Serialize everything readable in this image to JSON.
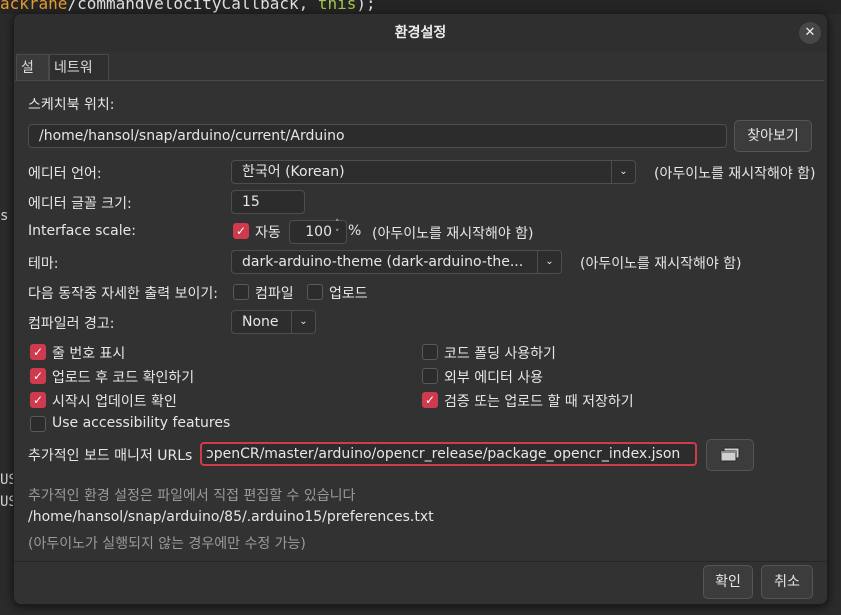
{
  "background": {
    "code_line_parts": [
      "ackrane",
      "/commandVelocityCallback",
      ", ",
      "this",
      ");"
    ],
    "left_fragments": [
      "s T",
      "US",
      "US"
    ]
  },
  "dialog": {
    "title": "환경설정",
    "close_glyph": "✕",
    "tabs": [
      "설정",
      "네트워크"
    ],
    "sketchbook": {
      "label": "스케치북 위치:",
      "path": "/home/hansol/snap/arduino/current/Arduino",
      "browse_label": "찾아보기"
    },
    "editor_language": {
      "label": "에디터 언어:",
      "value": "한국어 (Korean)",
      "note": "(아두이노를 재시작해야 함)"
    },
    "font_size": {
      "label": "에디터 글꼴 크기:",
      "value": "15"
    },
    "interface_scale": {
      "label": "Interface scale:",
      "auto_label": "자동",
      "auto_checked": true,
      "value": "100",
      "unit": "%",
      "note": "(아두이노를 재시작해야 함)"
    },
    "theme": {
      "label": "테마:",
      "value": "dark-arduino-theme  (dark-arduino-the...",
      "note": "(아두이노를 재시작해야 함)"
    },
    "verbose": {
      "label": "다음 동작중 자세한 출력 보이기:",
      "compile_label": "컴파일",
      "compile_checked": false,
      "upload_label": "업로드",
      "upload_checked": false
    },
    "warnings": {
      "label": "컴파일러 경고:",
      "value": "None"
    },
    "checkboxes_left": [
      {
        "label": "줄 번호 표시",
        "checked": true
      },
      {
        "label": "업로드 후 코드 확인하기",
        "checked": true
      },
      {
        "label": "시작시 업데이트 확인",
        "checked": true
      },
      {
        "label": "Use accessibility features",
        "checked": false
      }
    ],
    "checkboxes_right": [
      {
        "label": "코드 폴딩 사용하기",
        "checked": false
      },
      {
        "label": "외부 에디터 사용",
        "checked": false
      },
      {
        "label": "검증 또는 업로드 할 때 저장하기",
        "checked": true
      }
    ],
    "board_urls": {
      "label": "추가적인 보드 매니저 URLs",
      "value": "ɔpenCR/master/arduino/opencr_release/package_opencr_index.json"
    },
    "more_prefs_text": "추가적인 환경 설정은 파일에서 직접 편집할 수 있습니다",
    "prefs_path": "/home/hansol/snap/arduino/85/.arduino15/preferences.txt",
    "edit_note": "(아두이노가 실행되지 않는 경우에만 수정 가능)",
    "ok_label": "확인",
    "cancel_label": "취소"
  },
  "colors": {
    "accent": "#d03a4e",
    "dialog_bg": "#323232"
  }
}
